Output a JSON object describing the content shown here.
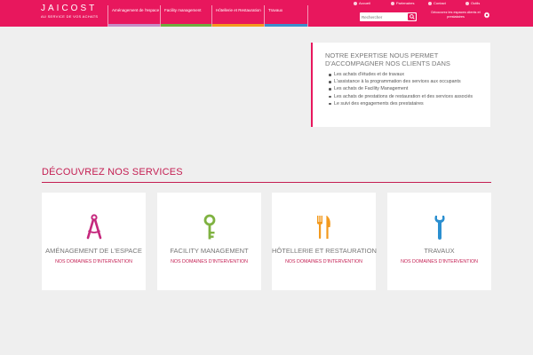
{
  "colors": {
    "brand": "#e8175d",
    "accent_text": "#c41e52",
    "nav_espace": "#c58bc5",
    "nav_fm": "#6fae3f",
    "nav_hotel": "#f39a1e",
    "nav_travaux": "#3a8fcb"
  },
  "header": {
    "logo_title": "JAICOST",
    "logo_subtitle": "AU SERVICE DE VOS ACHATS",
    "nav": [
      {
        "label": "Aménagement de l'espace"
      },
      {
        "label": "Facility management"
      },
      {
        "label": "Hôtellerie et Restauration"
      },
      {
        "label": "Travaux"
      }
    ],
    "top_links": [
      {
        "icon": "home-icon",
        "label": "Accueil"
      },
      {
        "icon": "user-icon",
        "label": "Partenaires"
      },
      {
        "icon": "mail-icon",
        "label": "Contact"
      },
      {
        "icon": "gear-icon",
        "label": "Outils"
      }
    ],
    "search_placeholder": "Rechercher",
    "login_text": "Découvrez les espaces clients et prestataires"
  },
  "expertise": {
    "title": "Notre expertise nous permet d'accompagner nos clients dans",
    "items": [
      "Les achats d'études et de travaux",
      "L'assistance à la programmation des services aux occupants",
      "Les achats de Facility Management",
      "Les achats de prestations de restauration et des services associés",
      "Le suivi des engagements des prestataires"
    ]
  },
  "services": {
    "title": "DÉCOUVREZ NOS SERVICES",
    "link_label": "NOS DOMAINES D'INTERVENTION",
    "cards": [
      {
        "icon": "compass-icon",
        "color": "#c5287d",
        "title": "Aménagement de l'espace"
      },
      {
        "icon": "key-icon",
        "color": "#7fb241",
        "title": "Facility Management"
      },
      {
        "icon": "fork-knife-icon",
        "color": "#f39a1e",
        "title": "Hôtellerie et Restauration"
      },
      {
        "icon": "wrench-icon",
        "color": "#2b8fd0",
        "title": "Travaux"
      }
    ]
  }
}
